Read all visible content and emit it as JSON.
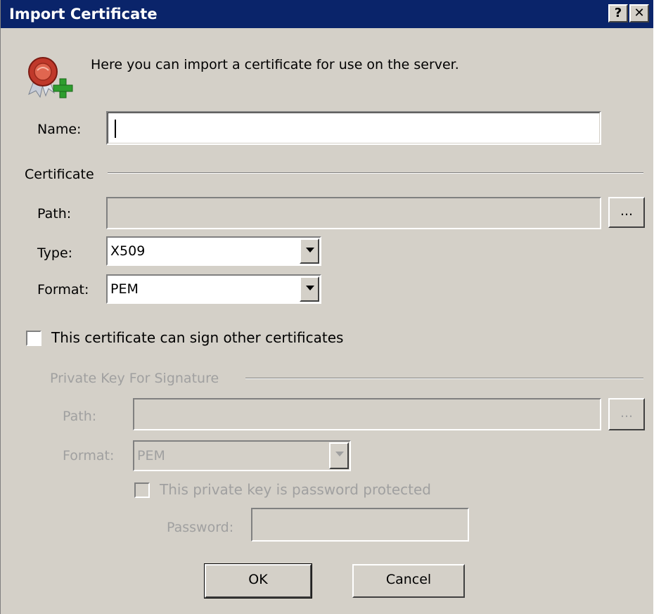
{
  "window": {
    "title": "Import Certificate",
    "help_glyph": "?",
    "close_glyph": "✕"
  },
  "intro": {
    "text": "Here you can import a certificate for use on the server.",
    "icon": "certificate-add-icon"
  },
  "name_field": {
    "label": "Name:",
    "value": ""
  },
  "certificate_group": {
    "title": "Certificate",
    "path_label": "Path:",
    "path_value": "",
    "browse_label": "...",
    "type_label": "Type:",
    "type_value": "X509",
    "format_label": "Format:",
    "format_value": "PEM"
  },
  "sign_checkbox": {
    "label": "This certificate can sign other certificates",
    "checked": false
  },
  "private_key_group": {
    "title": "Private Key For Signature",
    "path_label": "Path:",
    "path_value": "",
    "browse_label": "...",
    "format_label": "Format:",
    "format_value": "PEM",
    "password_protected_label": "This private key is password protected",
    "password_protected_checked": false,
    "password_label": "Password:",
    "password_value": ""
  },
  "buttons": {
    "ok_label": "OK",
    "cancel_label": "Cancel"
  },
  "colors": {
    "titlebar": "#0a246a",
    "dialog_bg": "#d4d0c8",
    "disabled_text": "#a0a0a0"
  }
}
